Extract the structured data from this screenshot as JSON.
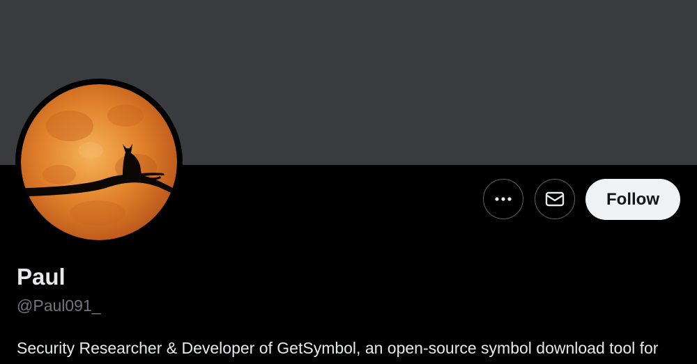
{
  "banner": {
    "color": "#3a3b3f"
  },
  "avatar": {
    "alt": "Profile photo"
  },
  "actions": {
    "more_icon": "more-horizontal-icon",
    "message_icon": "envelope-icon",
    "follow_label": "Follow"
  },
  "profile": {
    "display_name": "Paul",
    "handle": "@Paul091_",
    "bio": "Security Researcher & Developer of GetSymbol, an open-source symbol download tool for"
  },
  "colors": {
    "background": "#000000",
    "text_primary": "#e7e9ea",
    "text_secondary": "#71767b",
    "follow_bg": "#eff3f4",
    "moon": "#e8892c"
  }
}
